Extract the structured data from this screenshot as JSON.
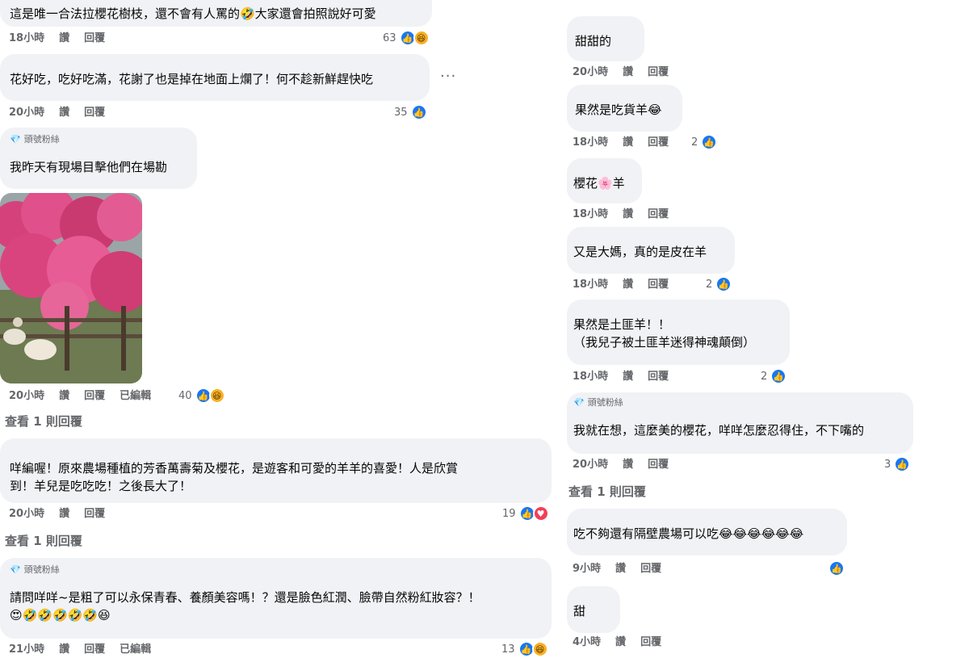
{
  "left": {
    "c1": {
      "text": "這是唯一合法拉櫻花樹枝，還不會有人罵的🤣大家還會拍照說好可愛",
      "time": "18小時",
      "like": "讚",
      "reply": "回覆",
      "count": "63"
    },
    "c2": {
      "text": "花好吃，吃好吃滿，花謝了也是掉在地面上爛了！何不趁新鮮趕快吃",
      "time": "20小時",
      "like": "讚",
      "reply": "回覆",
      "count": "35",
      "more": "···"
    },
    "c3": {
      "badge": "頭號粉絲",
      "text": "我昨天有現場目擊他們在場勘",
      "time": "20小時",
      "like": "讚",
      "reply": "回覆",
      "edited": "已編輯",
      "count": "40",
      "view_replies": "查看 1 則回覆"
    },
    "c4": {
      "text": "咩編喔！原來農場種植的芳香萬壽菊及櫻花，是遊客和可愛的羊羊的喜愛！人是欣賞\n到！羊兒是吃吃吃！之後長大了！",
      "time": "20小時",
      "like": "讚",
      "reply": "回覆",
      "count": "19",
      "view_replies": "查看 1 則回覆"
    },
    "c5": {
      "badge": "頭號粉絲",
      "text": "請問咩咩~是粗了可以永保青春、養顏美容嗎！？還是臉色紅潤、臉帶自然粉紅妝容？！\n😍🤣🤣🤣🤣🤣😆",
      "time": "21小時",
      "like": "讚",
      "reply": "回覆",
      "edited": "已編輯",
      "count": "13"
    }
  },
  "right": {
    "r1": {
      "text": "甜甜的",
      "time": "20小時",
      "like": "讚",
      "reply": "回覆"
    },
    "r2": {
      "text": "果然是吃貨羊😂",
      "time": "18小時",
      "like": "讚",
      "reply": "回覆",
      "count": "2"
    },
    "r3": {
      "text": "櫻花🌸羊",
      "time": "18小時",
      "like": "讚",
      "reply": "回覆"
    },
    "r4": {
      "text": "又是大媽，真的是皮在羊",
      "time": "18小時",
      "like": "讚",
      "reply": "回覆",
      "count": "2"
    },
    "r5": {
      "text": "果然是土匪羊！！\n（我兒子被土匪羊迷得神魂顛倒）",
      "time": "18小時",
      "like": "讚",
      "reply": "回覆",
      "count": "2"
    },
    "r6": {
      "badge": "頭號粉絲",
      "text": "我就在想，這麼美的櫻花，咩咩怎麼忍得住，不下嘴的",
      "time": "20小時",
      "like": "讚",
      "reply": "回覆",
      "count": "3",
      "view_replies": "查看 1 則回覆"
    },
    "r7": {
      "text": "吃不夠還有隔壁農場可以吃😂😂😂😂😂😂",
      "time": "9小時",
      "like": "讚",
      "reply": "回覆"
    },
    "r8": {
      "text": "甜",
      "time": "4小時",
      "like": "讚",
      "reply": "回覆"
    }
  }
}
